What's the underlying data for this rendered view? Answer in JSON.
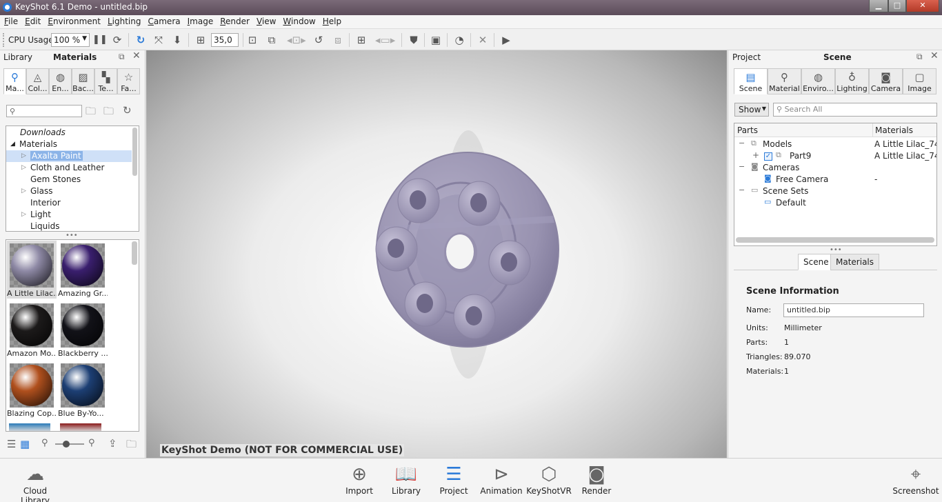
{
  "window": {
    "title": "KeyShot 6.1 Demo  - untitled.bip",
    "min": "▁",
    "max": "□",
    "close": "✕"
  },
  "menu": [
    "File",
    "Edit",
    "Environment",
    "Lighting",
    "Camera",
    "Image",
    "Render",
    "View",
    "Window",
    "Help"
  ],
  "toolbar": {
    "cpu_label": "CPU Usage",
    "cpu_value": "100 %",
    "angle_value": "35,0"
  },
  "library": {
    "title_left": "Library",
    "title_main": "Materials",
    "tabs": [
      "Ma...",
      "Col...",
      "En...",
      "Bac...",
      "Te...",
      "Fa..."
    ],
    "search_placeholder": "",
    "tree": [
      "Downloads",
      "Materials",
      "Axalta Paint",
      "Cloth and Leather",
      "Gem Stones",
      "Glass",
      "Interior",
      "Light",
      "Liquids"
    ],
    "thumbs": [
      {
        "label": "A Little Lilac...",
        "color": "#8f8aa6"
      },
      {
        "label": "Amazing Gr...",
        "color": "#3a1f6e"
      },
      {
        "label": "Amazon Mo...",
        "color": "#1c1a1a"
      },
      {
        "label": "Blackberry ...",
        "color": "#121218"
      },
      {
        "label": "Blazing Cop...",
        "color": "#b0501e"
      },
      {
        "label": "Blue By-Yo...",
        "color": "#1d3f74"
      }
    ]
  },
  "viewport": {
    "watermark": "KeyShot Demo (NOT FOR COMMERCIAL USE)"
  },
  "project": {
    "title_left": "Project",
    "title_main": "Scene",
    "tabs": [
      "Scene",
      "Material",
      "Enviro...",
      "Lighting",
      "Camera",
      "Image"
    ],
    "show_label": "Show",
    "search_placeholder": "Search All",
    "col_parts": "Parts",
    "col_materials": "Materials",
    "tree": [
      {
        "label": "Models",
        "mat": "A Little Lilac_74..."
      },
      {
        "label": "Part9",
        "mat": "A Little Lilac_74..."
      },
      {
        "label": "Cameras",
        "mat": ""
      },
      {
        "label": "Free Camera",
        "mat": "-"
      },
      {
        "label": "Scene Sets",
        "mat": ""
      },
      {
        "label": "Default",
        "mat": ""
      }
    ],
    "subtabs": [
      "Scene",
      "Materials"
    ],
    "info": {
      "heading": "Scene Information",
      "name_label": "Name:",
      "name_value": "untitled.bip",
      "units_label": "Units:",
      "units_value": "Millimeter",
      "parts_label": "Parts:",
      "parts_value": "1",
      "triangles_label": "Triangles:",
      "triangles_value": "89.070",
      "materials_label": "Materials:",
      "materials_value": "1"
    }
  },
  "bottom": {
    "cloud": "Cloud Library",
    "buttons": [
      "Import",
      "Library",
      "Project",
      "Animation",
      "KeyShotVR",
      "Render"
    ],
    "screenshot": "Screenshot"
  },
  "colors": {
    "accent": "#2a7ad8",
    "part": "#9e98b6"
  }
}
